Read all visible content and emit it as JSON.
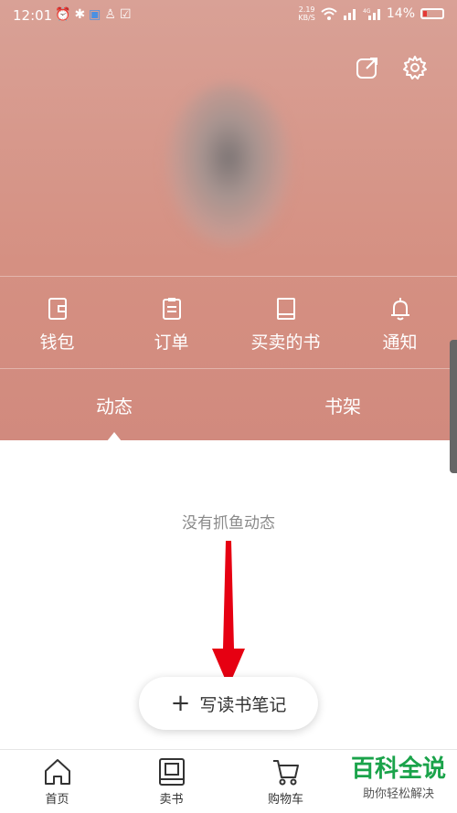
{
  "status_bar": {
    "time": "12:01",
    "net_speed_value": "2.19",
    "net_speed_unit": "KB/S",
    "battery": "14%",
    "icons": [
      "alarm-icon",
      "bluetooth-icon",
      "shield-icon",
      "qq-icon",
      "checkbox-icon",
      "wifi-icon",
      "signal-icon",
      "signal-4g-icon",
      "battery-icon"
    ],
    "battery_color": "#e53935"
  },
  "header": {
    "actions": [
      "share-icon",
      "settings-icon"
    ]
  },
  "menu": {
    "items": [
      {
        "label": "钱包",
        "icon": "wallet-icon"
      },
      {
        "label": "订单",
        "icon": "order-icon"
      },
      {
        "label": "买卖的书",
        "icon": "book-icon"
      },
      {
        "label": "通知",
        "icon": "bell-icon"
      }
    ]
  },
  "tabs": [
    {
      "label": "动态",
      "active": true
    },
    {
      "label": "书架",
      "active": false
    }
  ],
  "content": {
    "empty_text": "没有抓鱼动态"
  },
  "write_button": {
    "plus": "+",
    "label": "写读书笔记"
  },
  "bottom_nav": {
    "items": [
      {
        "label": "首页",
        "icon": "home-icon"
      },
      {
        "label": "卖书",
        "icon": "sell-book-icon"
      },
      {
        "label": "购物车",
        "icon": "cart-icon"
      }
    ]
  },
  "watermark": {
    "title": "百科全说",
    "subtitle": "助你轻松解决"
  },
  "colors": {
    "hero": "#d59082",
    "arrow": "#e60012",
    "watermark": "#1aa34a"
  }
}
